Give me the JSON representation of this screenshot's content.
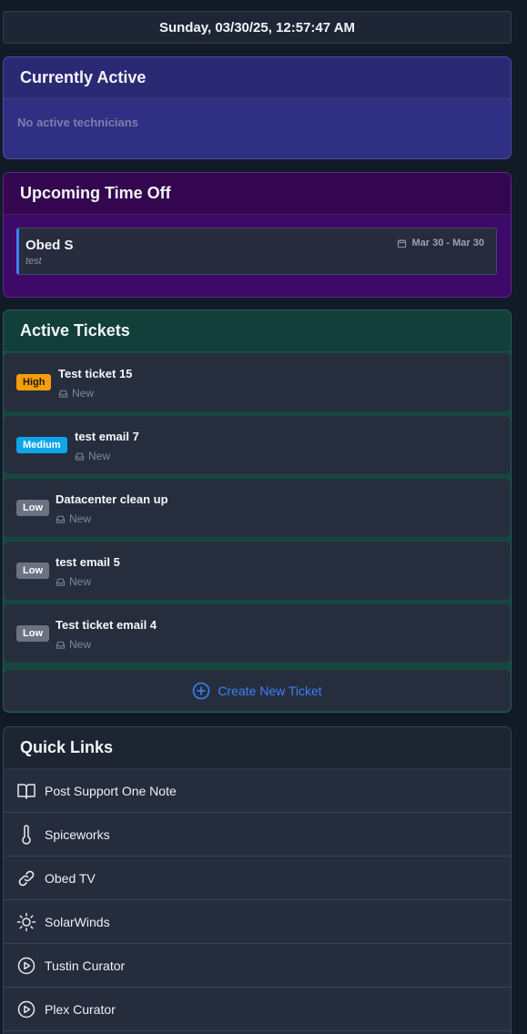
{
  "datetime": "Sunday, 03/30/25, 12:57:47 AM",
  "currently_active": {
    "title": "Currently Active",
    "empty_message": "No active technicians"
  },
  "time_off": {
    "title": "Upcoming Time Off",
    "items": [
      {
        "name": "Obed S",
        "note": "test",
        "dates": "Mar 30 - Mar 30",
        "icon": "calendar-icon"
      }
    ]
  },
  "tickets": {
    "title": "Active Tickets",
    "items": [
      {
        "priority": "High",
        "title": "Test ticket 15",
        "status": "New"
      },
      {
        "priority": "Medium",
        "title": "test email 7",
        "status": "New"
      },
      {
        "priority": "Low",
        "title": "Datacenter clean up",
        "status": "New"
      },
      {
        "priority": "Low",
        "title": "test email 5",
        "status": "New"
      },
      {
        "priority": "Low",
        "title": "Test ticket email 4",
        "status": "New"
      }
    ],
    "create_label": "Create New Ticket"
  },
  "quick_links": {
    "title": "Quick Links",
    "items": [
      {
        "label": "Post Support One Note",
        "icon": "book-icon"
      },
      {
        "label": "Spiceworks",
        "icon": "thermometer-icon"
      },
      {
        "label": "Obed TV",
        "icon": "link-icon"
      },
      {
        "label": "SolarWinds",
        "icon": "sun-icon"
      },
      {
        "label": "Tustin Curator",
        "icon": "play-circle-icon"
      },
      {
        "label": "Plex Curator",
        "icon": "play-circle-icon"
      }
    ]
  },
  "colors": {
    "accent": "#3b82f6",
    "priority_high": "#f59e0b",
    "priority_medium": "#0ea5e9",
    "priority_low": "#6b7280"
  }
}
